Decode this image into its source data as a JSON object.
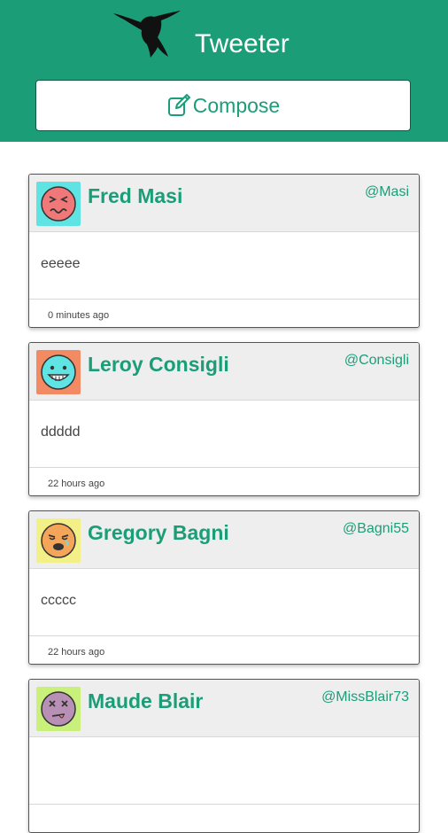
{
  "header": {
    "brand_icon": "hummingbird-icon",
    "title": "Tweeter",
    "compose_icon": "edit-icon",
    "compose_label": "Compose",
    "background_color": "#1b9e78"
  },
  "tweets": [
    {
      "name": "Fred Masi",
      "handle": "@Masi",
      "text": "eeeee",
      "time": "0 minutes ago",
      "avatar": {
        "icon": "confounded-face-avatar",
        "bg": "#5fe3e3",
        "face": "#f07878"
      }
    },
    {
      "name": "Leroy Consigli",
      "handle": "@Consigli",
      "text": "ddddd",
      "time": "22 hours ago",
      "avatar": {
        "icon": "grinning-face-avatar",
        "bg": "#f28a63",
        "face": "#5fe3e3"
      }
    },
    {
      "name": "Gregory Bagni",
      "handle": "@Bagni55",
      "text": "ccccc",
      "time": "22 hours ago",
      "avatar": {
        "icon": "tired-face-avatar",
        "bg": "#f2f086",
        "face": "#f5a55a"
      }
    },
    {
      "name": "Maude Blair",
      "handle": "@MissBlair73",
      "text": "",
      "time": "",
      "avatar": {
        "icon": "dizzy-face-avatar",
        "bg": "#c8f07a",
        "face": "#b990b5"
      }
    }
  ]
}
